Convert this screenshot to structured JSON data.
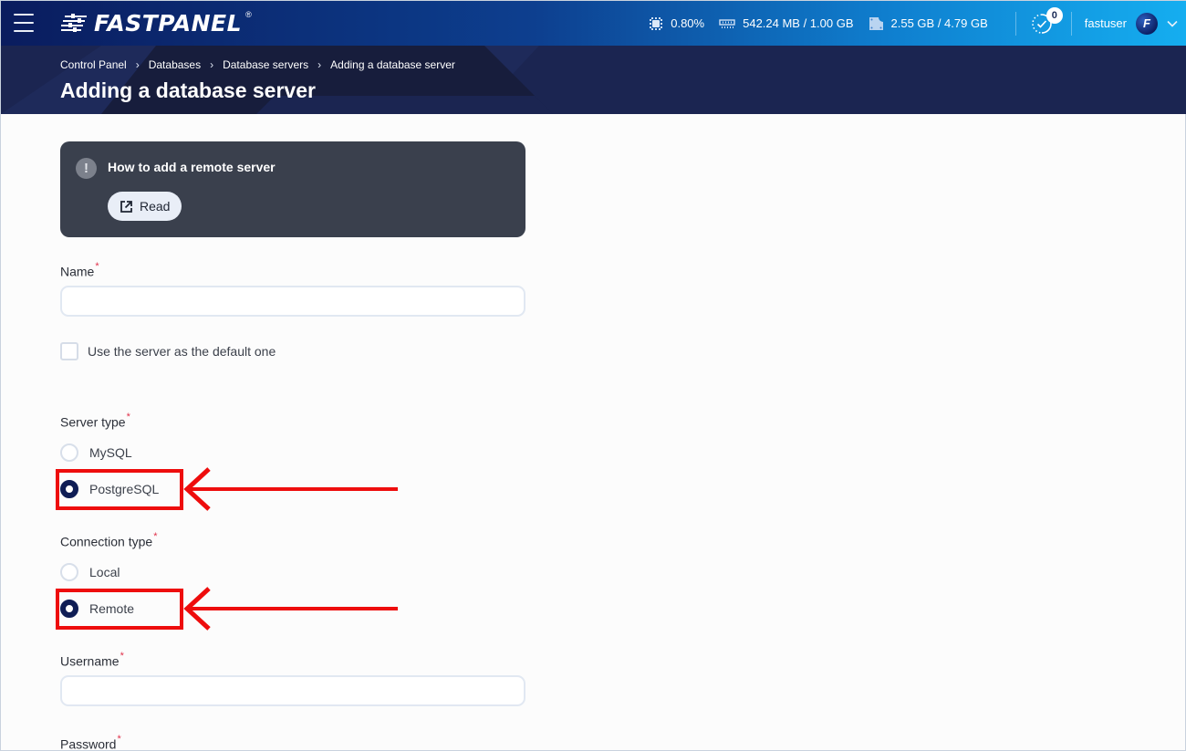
{
  "topbar": {
    "menu_icon": "hamburger-menu-icon",
    "logo_text": "FASTPANEL",
    "logo_registered": "®",
    "stats": {
      "cpu": {
        "icon": "cpu-icon",
        "value": "0.80%"
      },
      "ram": {
        "icon": "memory-icon",
        "value": "542.24 MB / 1.00 GB"
      },
      "disk": {
        "icon": "disk-icon",
        "value": "2.55 GB / 4.79 GB"
      }
    },
    "tasks": {
      "icon": "tasks-progress-icon",
      "count": "0"
    },
    "user": {
      "name": "fastuser",
      "avatar_letter": "F",
      "dropdown_icon": "chevron-down-icon"
    }
  },
  "header": {
    "breadcrumb": [
      {
        "label": "Control Panel"
      },
      {
        "label": "Databases"
      },
      {
        "label": "Database servers"
      },
      {
        "label": "Adding a database server"
      }
    ],
    "breadcrumb_separator": "›",
    "title": "Adding a database server"
  },
  "info_card": {
    "icon": "exclamation-icon",
    "icon_glyph": "!",
    "title": "How to add a remote server",
    "button_label": "Read",
    "button_icon": "external-link-icon"
  },
  "form": {
    "required_mark": "*",
    "name": {
      "label": "Name",
      "value": "",
      "placeholder": ""
    },
    "default_checkbox": {
      "label": "Use the server as the default one",
      "checked": false
    },
    "server_type": {
      "label": "Server type",
      "options": [
        {
          "label": "MySQL",
          "selected": false
        },
        {
          "label": "PostgreSQL",
          "selected": true
        }
      ]
    },
    "connection_type": {
      "label": "Connection type",
      "options": [
        {
          "label": "Local",
          "selected": false
        },
        {
          "label": "Remote",
          "selected": true
        }
      ]
    },
    "username": {
      "label": "Username",
      "value": "",
      "placeholder": ""
    },
    "password": {
      "label": "Password"
    }
  },
  "annotations": {
    "color": "#ee0d0d",
    "highlighted": [
      "PostgreSQL",
      "Remote"
    ]
  },
  "colors": {
    "topbar_start": "#0a1c5e",
    "topbar_end": "#15aef0",
    "header_bg": "#1b2551",
    "card_bg": "#3a404d",
    "radio_checked": "#0f1d55",
    "required": "#e0324b"
  }
}
